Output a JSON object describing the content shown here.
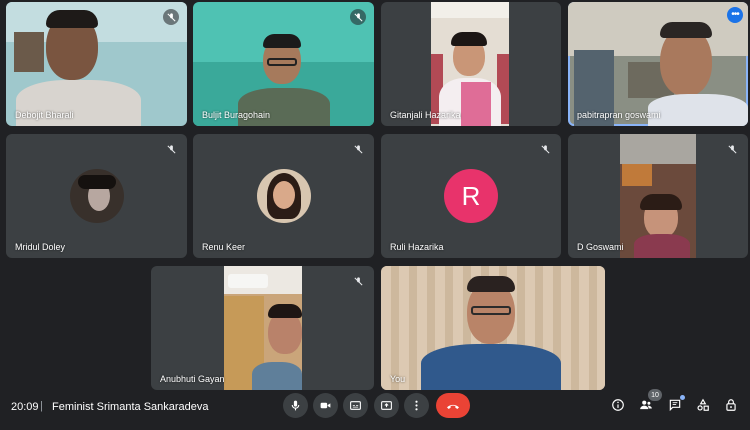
{
  "participants": [
    {
      "name": "Debojit Bharali",
      "muted": true
    },
    {
      "name": "Buljit Buragohain",
      "muted": true
    },
    {
      "name": "Gitanjali Hazarika",
      "muted": false
    },
    {
      "name": "pabitrapran goswami",
      "muted": false
    },
    {
      "name": "Mridul Doley",
      "muted": true
    },
    {
      "name": "Renu Keer",
      "muted": true
    },
    {
      "name": "Ruli Hazarika",
      "muted": true,
      "initial": "R"
    },
    {
      "name": "D Goswami",
      "muted": true
    },
    {
      "name": "Anubhuti Gayan",
      "muted": true
    },
    {
      "name": "You",
      "muted": false
    }
  ],
  "bottom_bar": {
    "time": "20:09",
    "separator": "|",
    "meeting_title": "Feminist Srimanta Sankaradeva",
    "people_count": "10"
  },
  "icons": {
    "mute": "mic-off-icon",
    "more": "more-options-icon",
    "mic": "microphone-icon",
    "camera": "camera-icon",
    "captions": "captions-icon",
    "present": "present-screen-icon",
    "more_vert": "more-vert-icon",
    "end_call": "end-call-icon",
    "info": "info-icon",
    "people": "people-icon",
    "chat": "chat-icon",
    "activities": "activities-icon",
    "host_controls": "host-controls-icon"
  },
  "colors": {
    "background": "#202124",
    "tile": "#3c4043",
    "accent": "#1a73e8",
    "end_call": "#ea4335",
    "avatar_r": "#e8336b"
  }
}
